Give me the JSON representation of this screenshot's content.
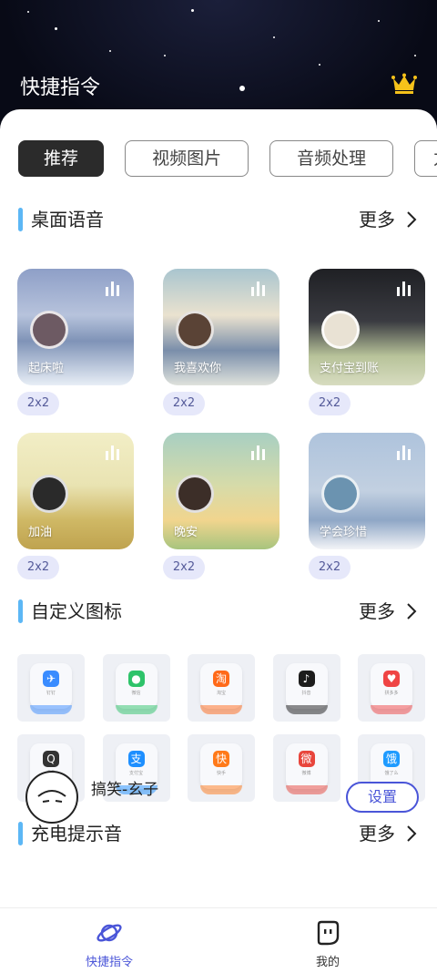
{
  "header": {
    "title": "快捷指令"
  },
  "tabs": [
    {
      "label": "推荐",
      "active": true
    },
    {
      "label": "视频图片",
      "active": false
    },
    {
      "label": "音频处理",
      "active": false
    },
    {
      "label": "力",
      "active": false
    }
  ],
  "sections": {
    "voice": {
      "title": "桌面语音",
      "more": "更多"
    },
    "icons": {
      "title": "自定义图标",
      "more": "更多"
    },
    "charge": {
      "title": "充电提示音",
      "more": "更多"
    }
  },
  "voice_cards": [
    {
      "label": "起床啦",
      "size": "2x2"
    },
    {
      "label": "我喜欢你",
      "size": "2x2"
    },
    {
      "label": "支付宝到账",
      "size": "2x2"
    },
    {
      "label": "加油",
      "size": "2x2"
    },
    {
      "label": "晚安",
      "size": "2x2"
    },
    {
      "label": "学会珍惜",
      "size": "2x2"
    }
  ],
  "custom_icons": [
    {
      "name": "钉钉",
      "icon": "dingtalk-icon",
      "color": "#3a8cff"
    },
    {
      "name": "微信",
      "icon": "wechat-icon",
      "color": "#2ec36a"
    },
    {
      "name": "淘宝",
      "icon": "taobao-icon",
      "color": "#ff6a1a"
    },
    {
      "name": "抖音",
      "icon": "douyin-icon",
      "color": "#1c1c1c"
    },
    {
      "name": "拼多多",
      "icon": "pinduoduo-icon",
      "color": "#ef4444"
    },
    {
      "name": "QQ",
      "icon": "qq-icon",
      "color": "#333333"
    },
    {
      "name": "支付宝",
      "icon": "alipay-icon",
      "color": "#1e8fff"
    },
    {
      "name": "快手",
      "icon": "kuaishou-icon",
      "color": "#ff7a1a"
    },
    {
      "name": "微博",
      "icon": "weibo-icon",
      "color": "#e8453c"
    },
    {
      "name": "饿了么",
      "icon": "eleme-icon",
      "color": "#1f9bff"
    }
  ],
  "charge_sound": {
    "name": "搞笑-玄子",
    "button": "设置"
  },
  "bottom_nav": [
    {
      "label": "快捷指令",
      "active": true
    },
    {
      "label": "我的",
      "active": false
    }
  ],
  "colors": {
    "accent": "#4a55d8",
    "section_bar": "#5cb7f5",
    "pill_bg": "#e6e8fa"
  }
}
